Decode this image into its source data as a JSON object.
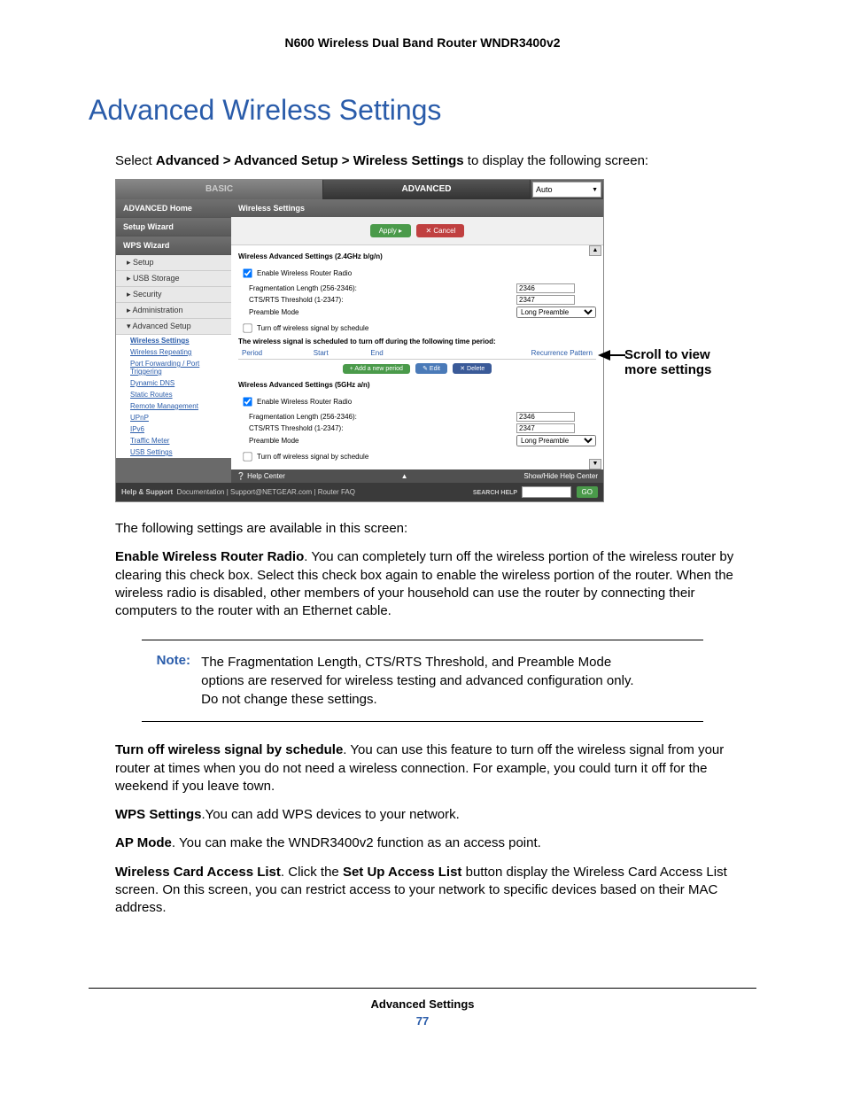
{
  "header": "N600 Wireless Dual Band Router WNDR3400v2",
  "title": "Advanced Wireless Settings",
  "intro_pre": "Select ",
  "intro_bold": "Advanced > Advanced Setup > Wireless Settings",
  "intro_post": " to display the following screen:",
  "ui": {
    "tabs": {
      "basic": "BASIC",
      "advanced": "ADVANCED",
      "auto": "Auto"
    },
    "sidebar": {
      "home": "ADVANCED Home",
      "setup_wizard": "Setup Wizard",
      "wps_wizard": "WPS Wizard",
      "setup": "▸ Setup",
      "usb": "▸ USB Storage",
      "security": "▸ Security",
      "admin": "▸ Administration",
      "adv_setup": "▾ Advanced Setup",
      "links": {
        "wireless_settings": "Wireless Settings",
        "wireless_repeating": "Wireless Repeating",
        "port_fw": "Port Forwarding / Port Triggering",
        "ddns": "Dynamic DNS",
        "static_routes": "Static Routes",
        "remote_mgmt": "Remote Management",
        "upnp": "UPnP",
        "ipv6": "IPv6",
        "traffic": "Traffic Meter",
        "usb_settings": "USB Settings"
      }
    },
    "content_header": "Wireless Settings",
    "apply": "Apply ▸",
    "cancel": "✕ Cancel",
    "section24": "Wireless Advanced Settings (2.4GHz b/g/n)",
    "enable_radio": "Enable Wireless Router Radio",
    "frag": "Fragmentation Length (256-2346):",
    "frag_val": "2346",
    "cts": "CTS/RTS Threshold (1-2347):",
    "cts_val": "2347",
    "preamble": "Preamble Mode",
    "preamble_val": "Long Preamble",
    "turnoff": "Turn off wireless signal by schedule",
    "sched_note": "The wireless signal is scheduled to turn off during the following time period:",
    "table": {
      "period": "Period",
      "start": "Start",
      "end": "End",
      "recur": "Recurrence Pattern"
    },
    "add": "+ Add a new period",
    "edit": "✎ Edit",
    "delete": "✕ Delete",
    "section5": "Wireless Advanced Settings (5GHz a/n)",
    "help_center": "❔ Help Center",
    "show_hide": "Show/Hide Help Center",
    "help_support": "Help & Support",
    "doc": "Documentation",
    "support_link": "Support@NETGEAR.com",
    "router_faq": "Router FAQ",
    "search_help": "SEARCH HELP",
    "go": "GO"
  },
  "annotation": "Scroll to view more settings",
  "after_intro": "The following settings are available in this screen:",
  "p1_b": "Enable Wireless Router Radio",
  "p1": ". You can completely turn off the wireless portion of the wireless router by clearing this check box. Select this check box again to enable the wireless portion of the router. When the wireless radio is disabled, other members of your household can use the router by connecting their computers to the router with an Ethernet cable.",
  "note_label": "Note:",
  "note_text": "The Fragmentation Length, CTS/RTS Threshold, and Preamble Mode options are reserved for wireless testing and advanced configuration only. Do not change these settings.",
  "p2_b": "Turn off wireless signal by schedule",
  "p2": ". You can use this feature to turn off the wireless signal from your router at times when you do not need a wireless connection. For example, you could turn it off for the weekend if you leave town.",
  "p3_b": "WPS Settings",
  "p3": ".You can add WPS devices to your network.",
  "p4_b": "AP Mode",
  "p4": ". You can make the WNDR3400v2 function as an access point.",
  "p5_b": "Wireless Card Access List",
  "p5_mid": ". Click the ",
  "p5_b2": "Set Up Access List",
  "p5_end": " button display the Wireless Card Access List screen. On this screen, you can restrict access to your network to specific devices based on their MAC address.",
  "footer_section": "Advanced Settings",
  "footer_page": "77"
}
